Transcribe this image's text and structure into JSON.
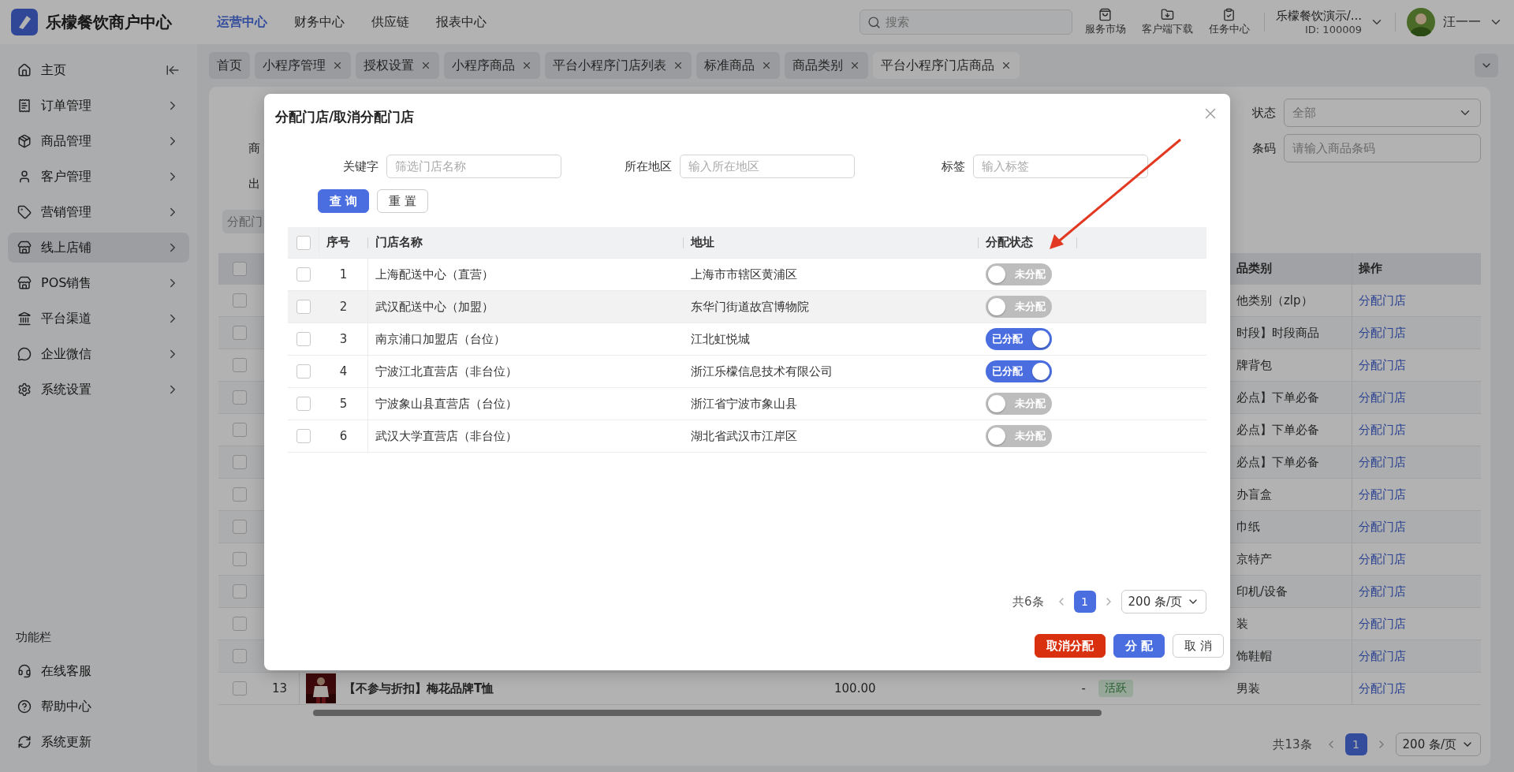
{
  "header": {
    "logo": "乐檬餐饮商户中心",
    "nav": [
      {
        "label": "运营中心",
        "selected": true
      },
      {
        "label": "财务中心",
        "selected": false
      },
      {
        "label": "供应链",
        "selected": false
      },
      {
        "label": "报表中心",
        "selected": false
      }
    ],
    "search": {
      "placeholder": "搜索"
    },
    "tools": [
      {
        "kind": "market",
        "label": "服务市场"
      },
      {
        "kind": "download",
        "label": "客户端下载"
      },
      {
        "kind": "task",
        "label": "任务中心"
      }
    ],
    "account": {
      "name": "乐檬餐饮演示/...",
      "id": "ID: 100009"
    },
    "user": {
      "name": "汪一一"
    }
  },
  "sidebar": {
    "items": [
      {
        "kind": "home",
        "label": "主页",
        "selected": false
      },
      {
        "kind": "orders",
        "label": "订单管理",
        "selected": false
      },
      {
        "kind": "goods",
        "label": "商品管理",
        "selected": false
      },
      {
        "kind": "customer",
        "label": "客户管理",
        "selected": false
      },
      {
        "kind": "marketing",
        "label": "营销管理",
        "selected": false
      },
      {
        "kind": "shop",
        "label": "线上店铺",
        "selected": true
      },
      {
        "kind": "pos",
        "label": "POS销售",
        "selected": false
      },
      {
        "kind": "channel",
        "label": "平台渠道",
        "selected": false
      },
      {
        "kind": "wechat",
        "label": "企业微信",
        "selected": false
      },
      {
        "kind": "settings",
        "label": "系统设置",
        "selected": false
      }
    ],
    "footer_title": "功能栏",
    "footer_items": [
      {
        "kind": "service",
        "label": "在线客服"
      },
      {
        "kind": "help",
        "label": "帮助中心"
      },
      {
        "kind": "update",
        "label": "系统更新"
      }
    ]
  },
  "tabs": [
    {
      "label": "首页",
      "selected": false,
      "closable": false
    },
    {
      "label": "小程序管理",
      "selected": false,
      "closable": true
    },
    {
      "label": "授权设置",
      "selected": false,
      "closable": true
    },
    {
      "label": "小程序商品",
      "selected": false,
      "closable": true
    },
    {
      "label": "平台小程序门店列表",
      "selected": false,
      "closable": true
    },
    {
      "label": "标准商品",
      "selected": false,
      "closable": true
    },
    {
      "label": "商品类别",
      "selected": false,
      "closable": true
    },
    {
      "label": "平台小程序门店商品",
      "selected": true,
      "closable": true
    }
  ],
  "page": {
    "filters": {
      "status": {
        "label": "状态",
        "value": "全部"
      },
      "left_label_1": "商",
      "barcode": {
        "label": "条码",
        "placeholder": "请输入商品条码"
      },
      "left_label_2": "出"
    },
    "toolbar_button": "分配门",
    "table": {
      "select_all": false,
      "columns": {
        "category": "品类别",
        "action": "操作"
      },
      "rows": [
        {
          "checked": false,
          "category": "他类别（zlp）",
          "action": "分配门店"
        },
        {
          "checked": false,
          "category": "时段】时段商品",
          "action": "分配门店"
        },
        {
          "checked": false,
          "category": "牌背包",
          "action": "分配门店"
        },
        {
          "checked": false,
          "category": "必点】下单必备",
          "action": "分配门店"
        },
        {
          "checked": false,
          "category": "必点】下单必备",
          "action": "分配门店"
        },
        {
          "checked": false,
          "category": "必点】下单必备",
          "action": "分配门店"
        },
        {
          "checked": false,
          "category": "办盲盒",
          "action": "分配门店"
        },
        {
          "checked": false,
          "category": "巾纸",
          "action": "分配门店"
        },
        {
          "checked": false,
          "category": "京特产",
          "action": "分配门店"
        },
        {
          "checked": false,
          "category": "印机/设备",
          "action": "分配门店"
        },
        {
          "checked": false,
          "category": "装",
          "action": "分配门店"
        },
        {
          "checked": false,
          "category": "饰鞋帽",
          "action": "分配门店"
        },
        {
          "checked": false,
          "index": "13",
          "name": "【不参与折扣】梅花品牌T恤",
          "column_4": "100.00",
          "column_5": "-",
          "status": "活跃",
          "category": "男装",
          "action": "分配门店"
        }
      ]
    },
    "pagination": {
      "total": "共13条",
      "pages": [
        {
          "label": "1",
          "selected": true
        }
      ],
      "page_size": "200 条/页"
    }
  },
  "dialog": {
    "title": "分配门店/取消分配门店",
    "filters": [
      {
        "label": "关键字",
        "placeholder": "筛选门店名称"
      },
      {
        "label": "所在地区",
        "placeholder": "输入所在地区"
      },
      {
        "label": "标签",
        "placeholder": "输入标签"
      }
    ],
    "search_button": "查 询",
    "reset_button": "重 置",
    "table": {
      "select_all": false,
      "columns": [
        "序号",
        "门店名称",
        "地址",
        "分配状态"
      ],
      "rows": [
        {
          "index": "1",
          "name": "上海配送中心（直营）",
          "address": "上海市市辖区黄浦区",
          "assigned": false,
          "status_label": "未分配",
          "checked": false,
          "hovered": false
        },
        {
          "index": "2",
          "name": "武汉配送中心（加盟）",
          "address": "东华门街道故宫博物院",
          "assigned": false,
          "status_label": "未分配",
          "checked": false,
          "hovered": true
        },
        {
          "index": "3",
          "name": "南京浦口加盟店（台位）",
          "address": "江北虹悦城",
          "assigned": true,
          "status_label": "已分配",
          "checked": false,
          "hovered": false
        },
        {
          "index": "4",
          "name": "宁波江北直营店（非台位）",
          "address": "浙江乐檬信息技术有限公司",
          "assigned": true,
          "status_label": "已分配",
          "checked": false,
          "hovered": false
        },
        {
          "index": "5",
          "name": "宁波象山县直营店（台位）",
          "address": "浙江省宁波市象山县",
          "assigned": false,
          "status_label": "未分配",
          "checked": false,
          "hovered": false
        },
        {
          "index": "6",
          "name": "武汉大学直营店（非台位）",
          "address": "湖北省武汉市江岸区",
          "assigned": false,
          "status_label": "未分配",
          "checked": false,
          "hovered": false
        }
      ]
    },
    "pagination": {
      "total": "共6条",
      "pages": [
        {
          "label": "1",
          "selected": true
        }
      ],
      "page_size": "200 条/页"
    },
    "buttons": [
      {
        "kind": "danger",
        "label": "取消分配"
      },
      {
        "kind": "primary",
        "label": "分 配"
      },
      {
        "kind": "default",
        "label": "取 消"
      }
    ]
  }
}
